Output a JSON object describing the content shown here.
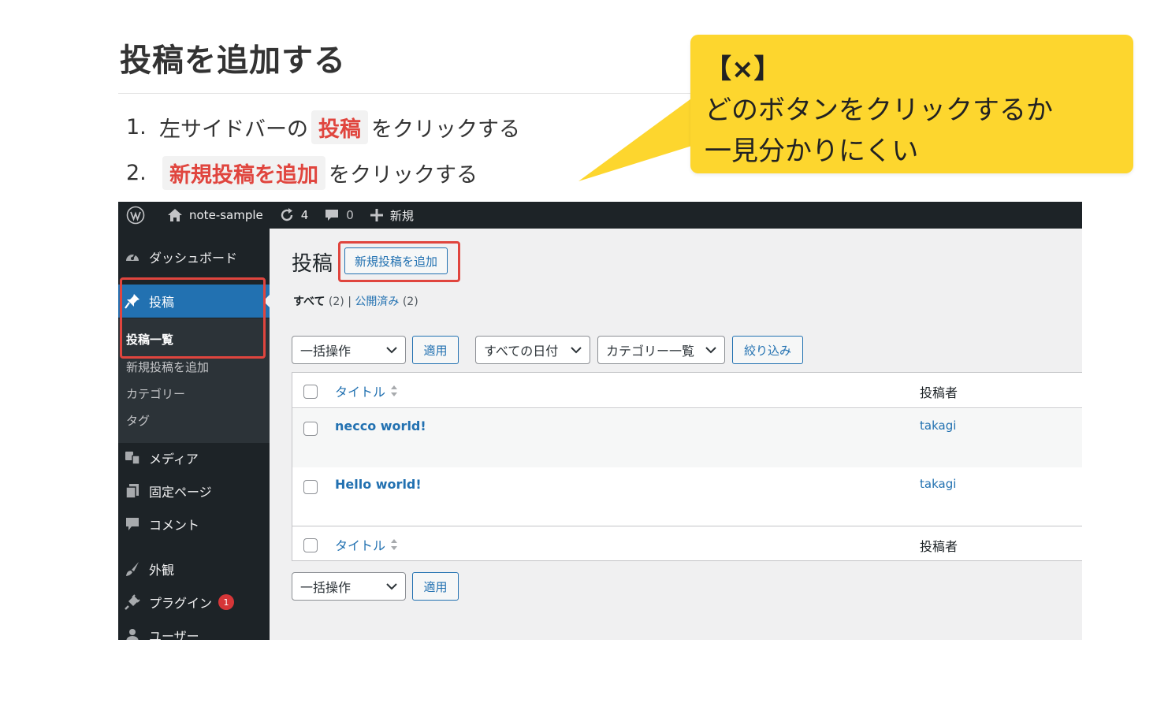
{
  "doc": {
    "title": "投稿を追加する",
    "steps": [
      {
        "num": "1.",
        "chip": "投稿",
        "text": "をクリックする",
        "prefix": "左サイドバーの"
      },
      {
        "num": "2.",
        "chip": "新規投稿を追加",
        "text": "をクリックする"
      }
    ]
  },
  "callout": {
    "head": "【×】",
    "line1": "どのボタンをクリックするか",
    "line2": "一見分かりにくい"
  },
  "adminbar": {
    "site_name": "note-sample",
    "updates": "4",
    "comments": "0",
    "new_label": "新規"
  },
  "sidebar": {
    "items": [
      {
        "label": "ダッシュボード",
        "icon": "dashboard-icon"
      },
      {
        "label": "投稿",
        "icon": "pin-icon"
      },
      {
        "label": "メディア",
        "icon": "media-icon"
      },
      {
        "label": "固定ページ",
        "icon": "pages-icon"
      },
      {
        "label": "コメント",
        "icon": "comment-icon"
      },
      {
        "label": "外観",
        "icon": "brush-icon"
      },
      {
        "label": "プラグイン",
        "icon": "plugin-icon",
        "badge": "1"
      },
      {
        "label": "ユーザー",
        "icon": "user-icon"
      }
    ],
    "submenu": [
      "投稿一覧",
      "新規投稿を追加",
      "カテゴリー",
      "タグ"
    ]
  },
  "main": {
    "page_title": "投稿",
    "add_new": "新規投稿を追加",
    "filters": {
      "all": "すべて",
      "all_count": "(2)",
      "sep": "|",
      "published": "公開済み",
      "published_count": "(2)"
    },
    "bulk_action": "一括操作",
    "apply": "適用",
    "date_filter": "すべての日付",
    "category_filter": "カテゴリー一覧",
    "filter_button": "絞り込み",
    "columns": {
      "title": "タイトル",
      "author": "投稿者"
    },
    "rows": [
      {
        "title": "necco world!",
        "author": "takagi"
      },
      {
        "title": "Hello world!",
        "author": "takagi"
      }
    ]
  },
  "colors": {
    "accent": "#2271b1",
    "admin_dark": "#1d2327",
    "highlight_red": "#e0453e",
    "callout_yellow": "#fdd62e"
  }
}
